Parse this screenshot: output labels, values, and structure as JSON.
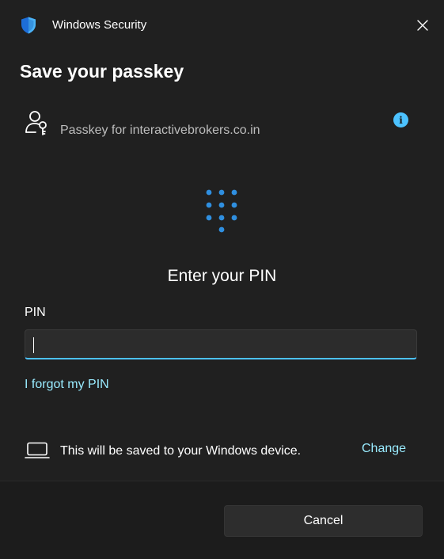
{
  "window": {
    "title": "Windows Security",
    "close_icon": "close-icon",
    "shield_icon": "windows-security-shield-icon"
  },
  "dialog": {
    "heading": "Save your passkey",
    "passkey_label": "Passkey for interactivebrokers.co.in",
    "info_glyph": "i",
    "enter_pin_heading": "Enter your PIN",
    "pin_field_label": "PIN",
    "pin_value": "",
    "forgot_link": "I forgot my PIN",
    "save_location_text": "This will be saved to your Windows device.",
    "change_link": "Change",
    "cancel_label": "Cancel"
  },
  "colors": {
    "background": "#202020",
    "footer": "#1c1c1c",
    "accent": "#4cc2ff",
    "link": "#99ebff",
    "muted_text": "#bdbdbd"
  }
}
